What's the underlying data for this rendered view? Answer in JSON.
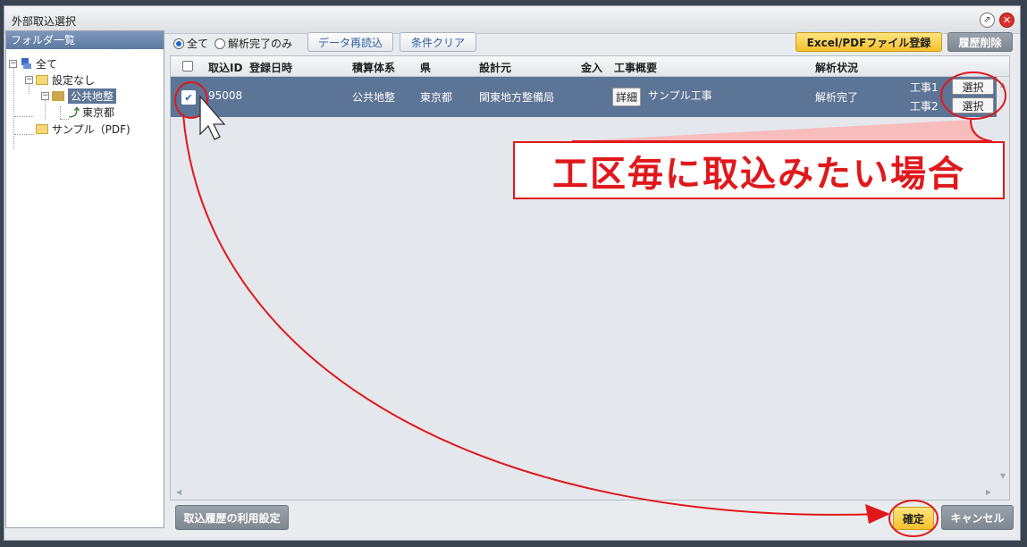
{
  "window": {
    "title": "外部取込選択"
  },
  "folder_panel": {
    "header": "フォルダ一覧",
    "tree": [
      {
        "label": "全て"
      },
      {
        "label": "設定なし"
      },
      {
        "label": "公共地整",
        "selected": true
      },
      {
        "label": "東京都"
      },
      {
        "label": "サンプル（PDF)"
      }
    ]
  },
  "toolbar": {
    "radio_all": "全て",
    "radio_done": "解析完了のみ",
    "reload_label": "データ再読込",
    "clear_label": "条件クリア",
    "register_label": "Excel/PDFファイル登録",
    "delete_history_label": "履歴削除"
  },
  "grid": {
    "columns": [
      "取込ID",
      "登録日時",
      "積算体系",
      "県",
      "設計元",
      "金入",
      "工事概要",
      "解析状況"
    ],
    "rows": [
      {
        "checked": true,
        "id": "95008",
        "date": "",
        "system": "公共地整",
        "prefecture": "東京都",
        "designer": "関東地方整備局",
        "amount": "",
        "detail_label": "詳細",
        "summary": "サンプル工事",
        "status": "解析完了",
        "sections": [
          {
            "label": "工事1",
            "button": "選択"
          },
          {
            "label": "工事2",
            "button": "選択"
          }
        ]
      }
    ]
  },
  "footer": {
    "history_settings_label": "取込履歴の利用設定",
    "ok_label": "確定",
    "cancel_label": "キャンセル"
  },
  "annotation": {
    "callout_text": "工区毎に取込みたい場合",
    "color": "#e0181c"
  }
}
